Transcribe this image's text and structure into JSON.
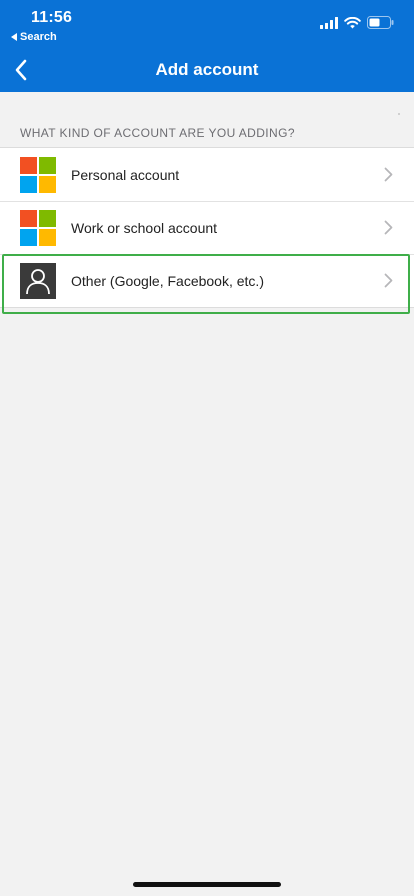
{
  "status_bar": {
    "time": "11:56",
    "back_app_label": "Search",
    "icons": [
      "signal-icon",
      "wifi-icon",
      "battery-icon"
    ]
  },
  "nav": {
    "title": "Add account",
    "back_icon": "chevron-left-icon"
  },
  "section": {
    "header": "WHAT KIND OF ACCOUNT ARE YOU ADDING?"
  },
  "accounts": [
    {
      "label": "Personal account",
      "icon": "microsoft-logo-icon"
    },
    {
      "label": "Work or school account",
      "icon": "microsoft-logo-icon"
    },
    {
      "label": "Other (Google, Facebook, etc.)",
      "icon": "person-icon"
    }
  ],
  "colors": {
    "header_blue": "#0a72d6",
    "ms_red": "#f25022",
    "ms_green": "#7fba00",
    "ms_blue": "#00a4ef",
    "ms_yellow": "#ffb900",
    "highlight_green": "#3fae49"
  }
}
